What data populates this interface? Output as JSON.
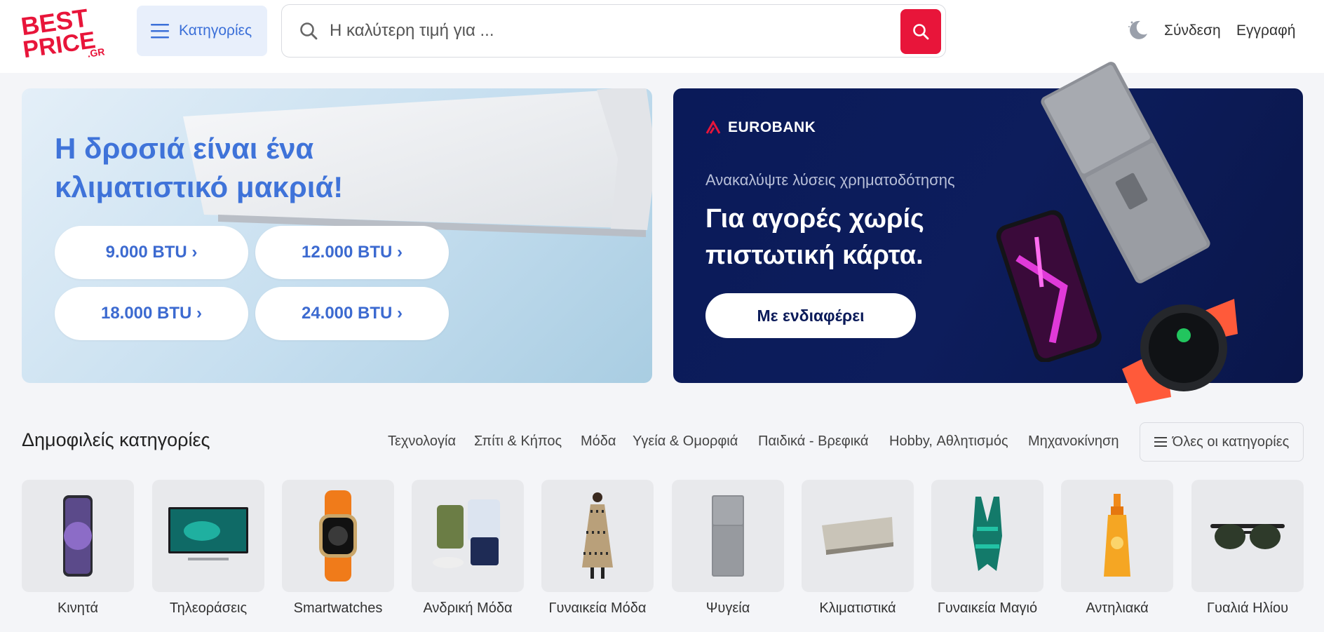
{
  "header": {
    "logo_text_top": "BEST",
    "logo_text_mid": "PRICE",
    "logo_text_sub": ".GR",
    "categories_label": "Κατηγορίες",
    "search_placeholder": "Η καλύτερη τιμή για ...",
    "login_label": "Σύνδεση",
    "register_label": "Εγγραφή"
  },
  "promo_left": {
    "title": "Η δροσιά είναι ένα κλιματιστικό μακριά!",
    "buttons": [
      "9.000 BTU ›",
      "12.000 BTU ›",
      "18.000 BTU ›",
      "24.000 BTU ›"
    ]
  },
  "promo_right": {
    "brand": "EUROBANK",
    "subtitle": "Ανακαλύψτε λύσεις χρηματοδότησης",
    "title": "Για αγορές χωρίς πιστωτική κάρτα.",
    "cta": "Με ενδιαφέρει"
  },
  "popular": {
    "title": "Δημοφιλείς κατηγορίες",
    "links": [
      "Τεχνολογία",
      "Σπίτι & Κήπος",
      "Μόδα",
      "Υγεία & Ομορφιά",
      "Παιδικά - Βρεφικά",
      "Hobby, Αθλητισμός",
      "Μηχανοκίνηση"
    ],
    "all_label": "Όλες οι κατηγορίες",
    "tiles": [
      "Κινητά",
      "Τηλεοράσεις",
      "Smartwatches",
      "Ανδρική Μόδα",
      "Γυναικεία Μόδα",
      "Ψυγεία",
      "Κλιματιστικά",
      "Γυναικεία Μαγιό",
      "Αντηλιακά",
      "Γυαλιά Ηλίου"
    ]
  },
  "colors": {
    "brand_red": "#e8153a",
    "accent_blue": "#3f73d9",
    "eurobank_navy": "#0a1a59"
  }
}
